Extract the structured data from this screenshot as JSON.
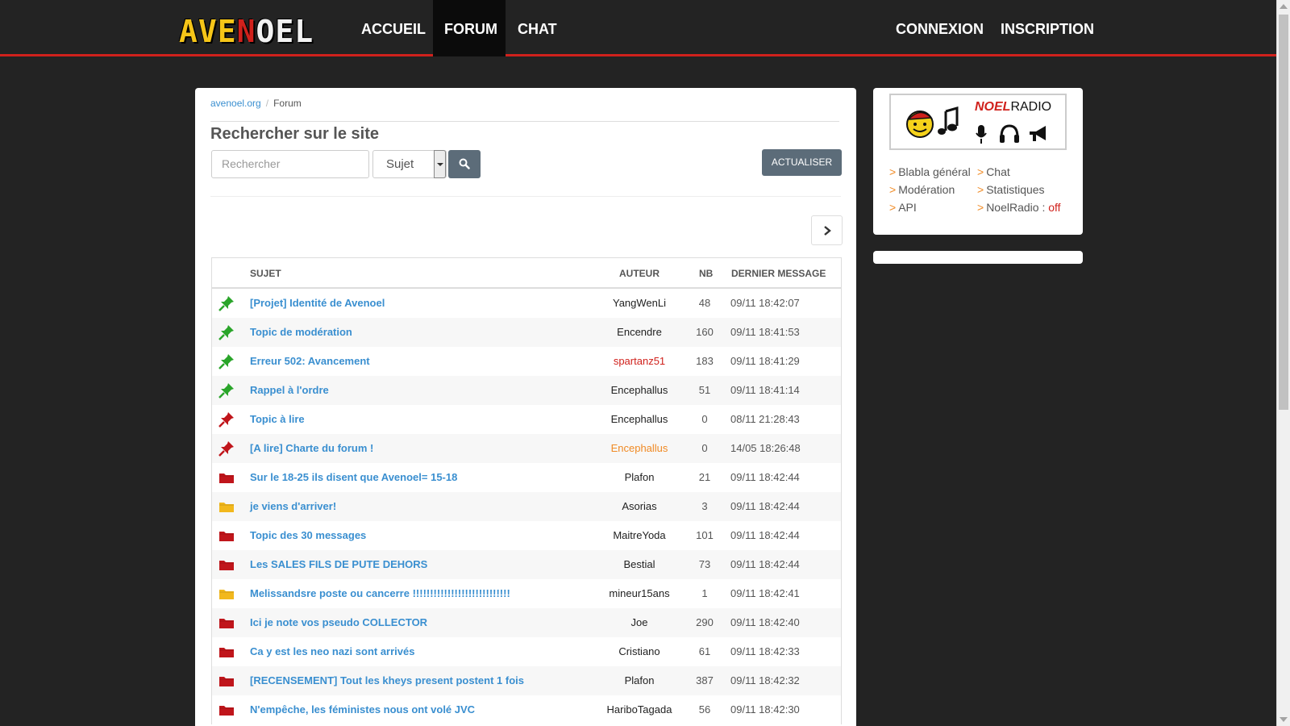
{
  "nav": {
    "logo": {
      "part1": "AVE",
      "part2": "N",
      "part3": "OEL"
    },
    "links": [
      "ACCUEIL",
      "FORUM",
      "CHAT"
    ],
    "right_links": [
      "CONNEXION",
      "INSCRIPTION"
    ]
  },
  "breadcrumb": {
    "home": "avenoel.org",
    "current": "Forum"
  },
  "search": {
    "title": "Rechercher sur le site",
    "placeholder": "Rechercher",
    "select_value": "Sujet",
    "refresh_label": "ACTUALISER"
  },
  "table": {
    "headers": {
      "subject": "SUJET",
      "author": "AUTEUR",
      "nb": "NB",
      "last": "DERNIER MESSAGE"
    },
    "rows": [
      {
        "icon": "pin-green",
        "subject": "[Projet] Identité de Avenoel",
        "author": "YangWenLi",
        "author_color": "#222222",
        "nb": "48",
        "date": "09/11 18:42:07"
      },
      {
        "icon": "pin-green",
        "subject": "Topic de modération",
        "author": "Encendre",
        "author_color": "#222222",
        "nb": "160",
        "date": "09/11 18:41:53"
      },
      {
        "icon": "pin-green",
        "subject": "Erreur 502: Avancement",
        "author": "spartanz51",
        "author_color": "#d0211c",
        "nb": "183",
        "date": "09/11 18:41:29"
      },
      {
        "icon": "pin-green",
        "subject": "Rappel à l'ordre",
        "author": "Encephallus",
        "author_color": "#222222",
        "nb": "51",
        "date": "09/11 18:41:14"
      },
      {
        "icon": "pin-red",
        "subject": "Topic à lire",
        "author": "Encephallus",
        "author_color": "#222222",
        "nb": "0",
        "date": "08/11 21:28:43"
      },
      {
        "icon": "pin-red",
        "subject": "[A lire] Charte du forum !",
        "author": "Encephallus",
        "author_color": "#f08a24",
        "nb": "0",
        "date": "14/05 18:26:48"
      },
      {
        "icon": "folder-red",
        "subject": "Sur le 18-25 ils disent que Avenoel= 15-18",
        "author": "Plafon",
        "author_color": "#222222",
        "nb": "21",
        "date": "09/11 18:42:44"
      },
      {
        "icon": "folder-yellow",
        "subject": "je viens d'arriver!",
        "author": "Asorias",
        "author_color": "#222222",
        "nb": "3",
        "date": "09/11 18:42:44"
      },
      {
        "icon": "folder-red",
        "subject": "Topic des 30 messages",
        "author": "MaitreYoda",
        "author_color": "#222222",
        "nb": "101",
        "date": "09/11 18:42:44"
      },
      {
        "icon": "folder-red",
        "subject": "Les SALES FILS DE PUTE DEHORS",
        "author": "Bestial",
        "author_color": "#222222",
        "nb": "73",
        "date": "09/11 18:42:44"
      },
      {
        "icon": "folder-yellow",
        "subject": "Melissandsre poste ou cancerre !!!!!!!!!!!!!!!!!!!!!!!!!!!!",
        "author": "mineur15ans",
        "author_color": "#222222",
        "nb": "1",
        "date": "09/11 18:42:41"
      },
      {
        "icon": "folder-red",
        "subject": "Ici je note vos pseudo COLLECTOR",
        "author": "Joe",
        "author_color": "#222222",
        "nb": "290",
        "date": "09/11 18:42:40"
      },
      {
        "icon": "folder-red",
        "subject": "Ca y est les neo nazi sont arrivés",
        "author": "Cristiano",
        "author_color": "#222222",
        "nb": "61",
        "date": "09/11 18:42:33"
      },
      {
        "icon": "folder-red",
        "subject": "[RECENSEMENT] Tout les kheys present postent 1 fois",
        "author": "Plafon",
        "author_color": "#222222",
        "nb": "387",
        "date": "09/11 18:42:32"
      },
      {
        "icon": "folder-red",
        "subject": "N'empêche, les féministes nous ont volé JVC",
        "author": "HariboTagada",
        "author_color": "#222222",
        "nb": "56",
        "date": "09/11 18:42:30"
      }
    ]
  },
  "sidebar": {
    "radio": {
      "noel": "NOEL",
      "radio": "RADIO"
    },
    "links": {
      "blabla": "Blabla général",
      "chat": "Chat",
      "moderation": "Modération",
      "stats": "Statistiques",
      "api": "API",
      "noelradio": "NoelRadio :",
      "noelradio_status": "off"
    }
  },
  "colors": {
    "accent_red": "#d0211c",
    "link_blue": "#3a8fd0",
    "pin_green": "#2aa52a",
    "folder_red": "#c0151b",
    "folder_yellow": "#f2b81d",
    "chevron_orange": "#f08a24"
  }
}
